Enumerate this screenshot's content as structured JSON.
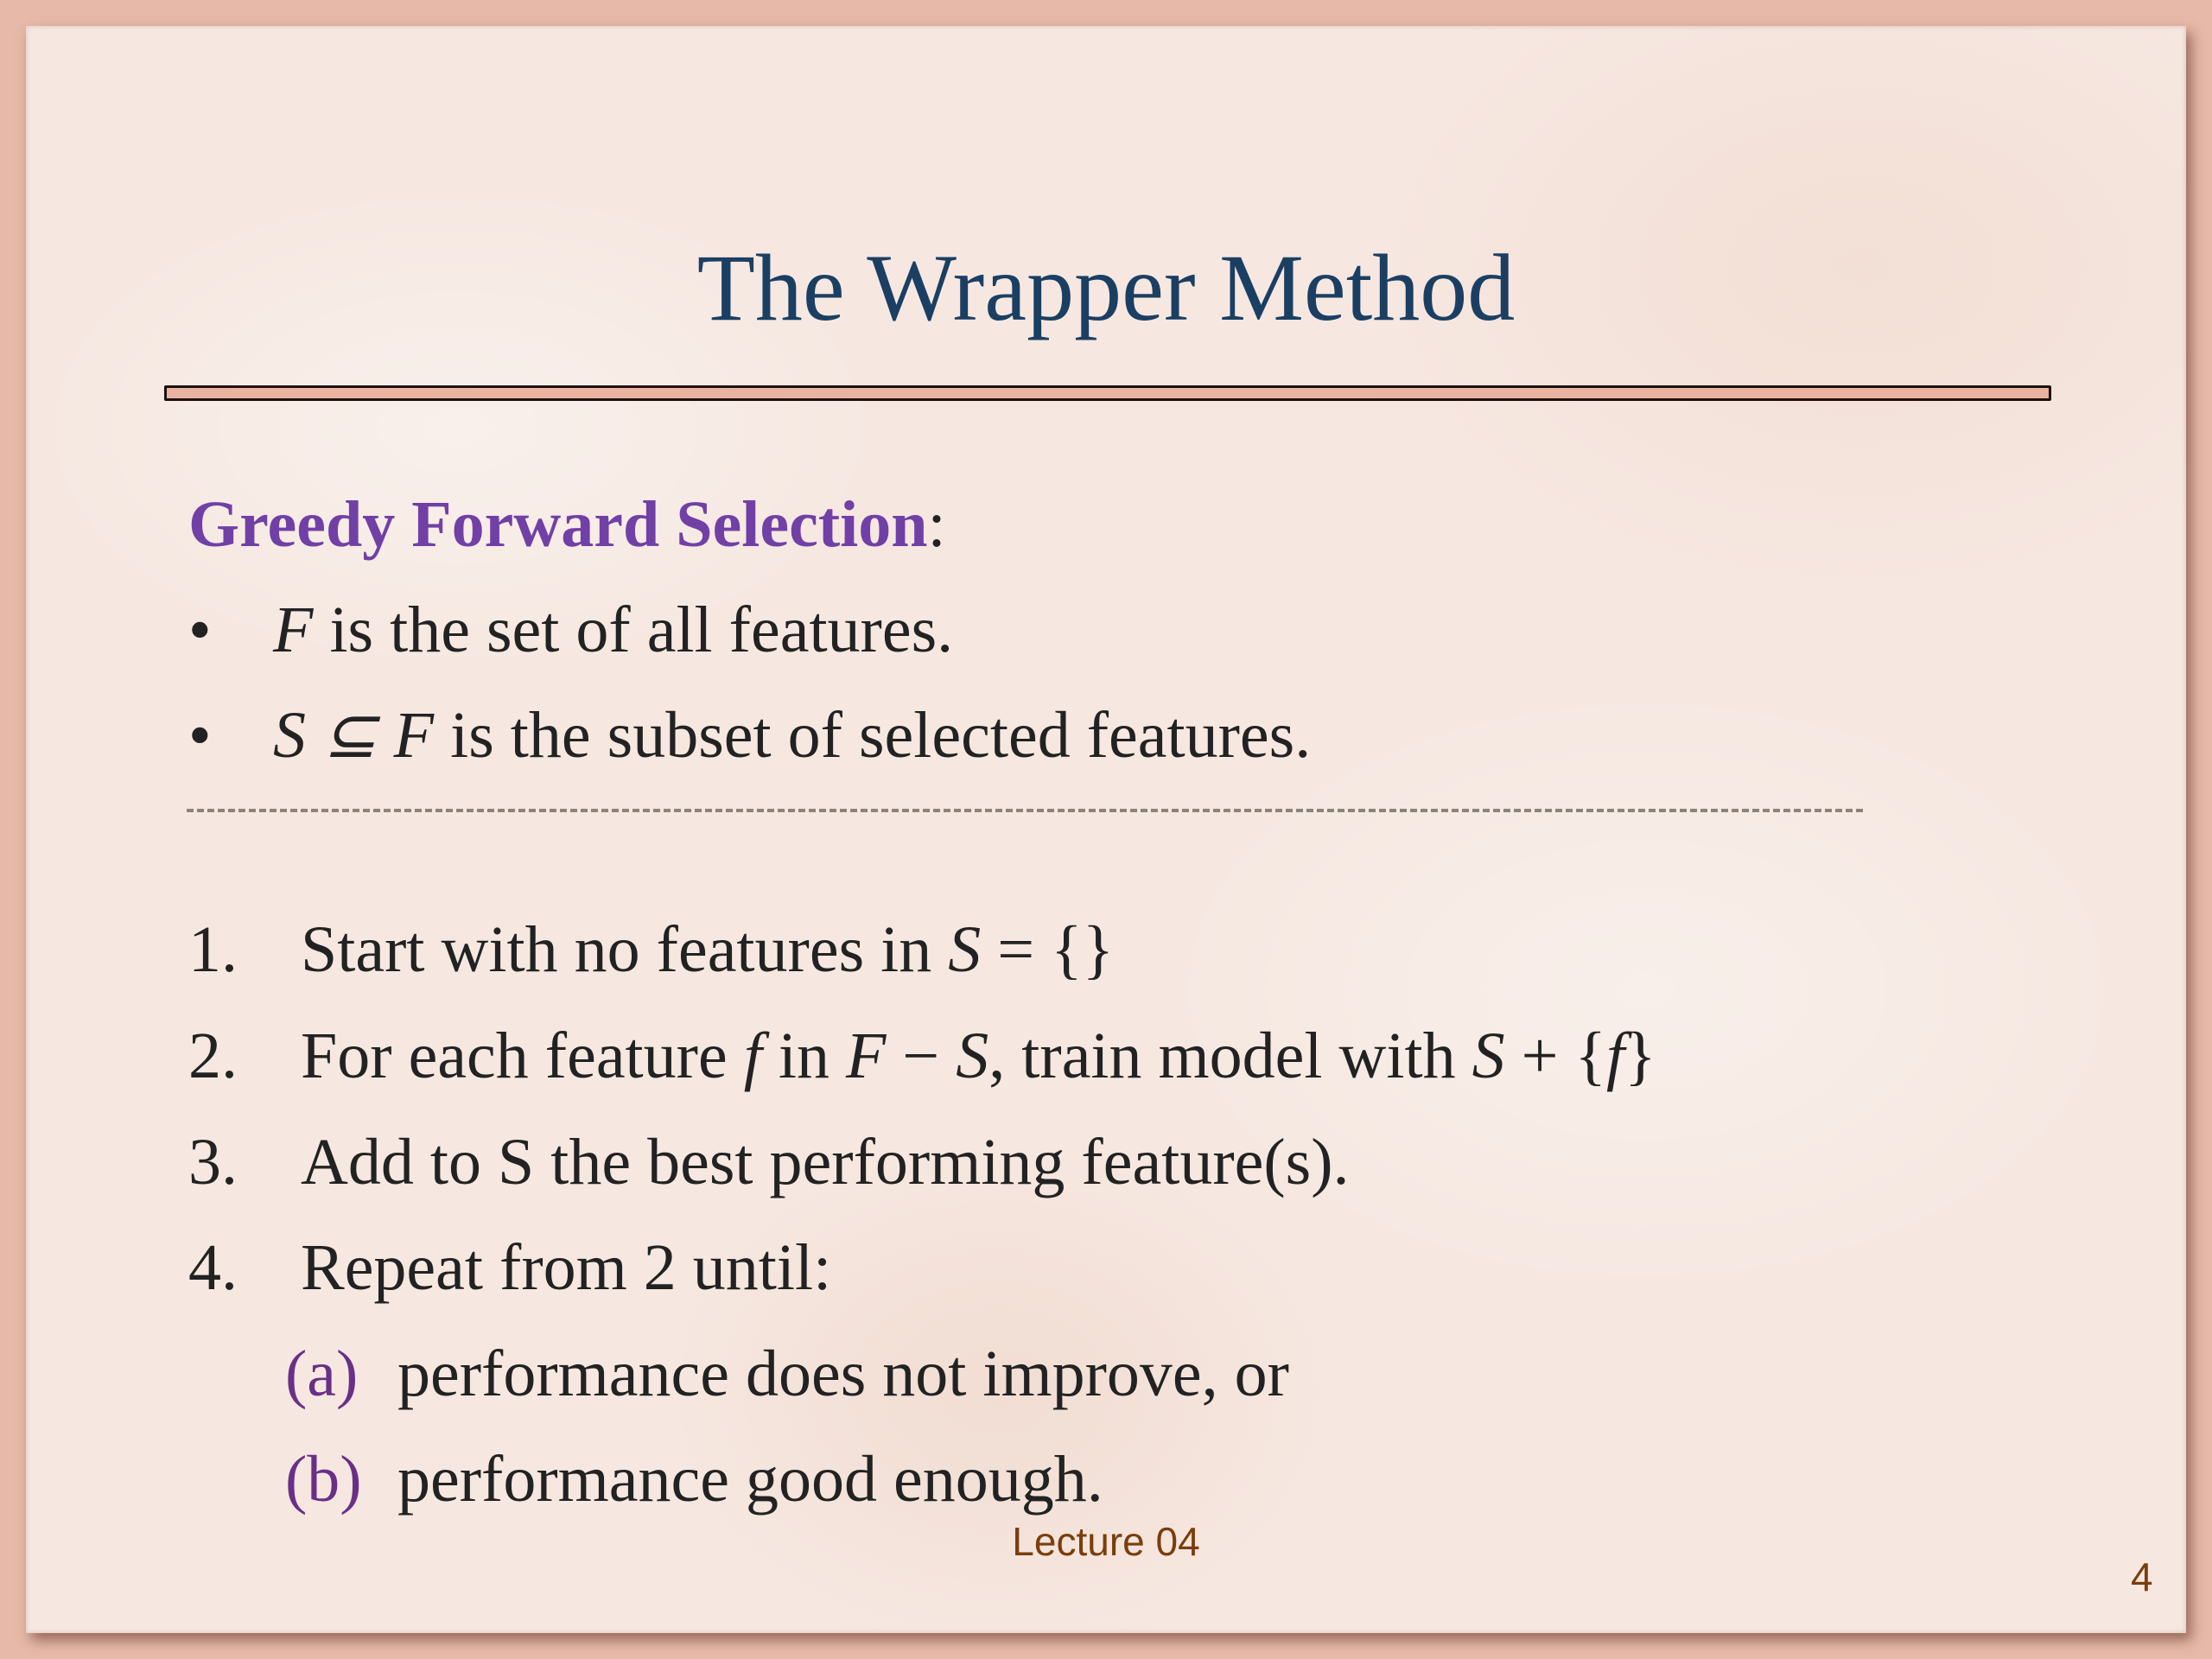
{
  "slide": {
    "title": "The Wrapper Method",
    "subheading": "Greedy Forward Selection",
    "subheading_suffix": ":",
    "bullets": [
      {
        "marker": "•",
        "math": "F",
        "text": " is the set of all features."
      },
      {
        "marker": "•",
        "math": "S ⊆ F",
        "text": " is the subset of selected features."
      }
    ],
    "steps": [
      {
        "num": "1.",
        "text": "Start with no features in ",
        "math": "S",
        "tail": " = {}"
      },
      {
        "num": "2.",
        "text": "For each feature ",
        "m1": "f",
        "t2": " in ",
        "m2": "F",
        "t3": " − ",
        "m3": "S",
        "t4": ", train model with ",
        "m4": "S",
        "t5": " + {",
        "m5": "f",
        "t6": "}"
      },
      {
        "num": "3.",
        "text": "Add to S the best performing feature(s)."
      },
      {
        "num": "4.",
        "text": "Repeat from 2 until:"
      }
    ],
    "substeps": [
      {
        "letter": "(a)",
        "text": "performance does not improve, or"
      },
      {
        "letter": "(b)",
        "text": "performance good enough."
      }
    ],
    "footer": "Lecture 04",
    "page_number": "4"
  },
  "colors": {
    "title": "#1b3f63",
    "subheading": "#7140a6",
    "sub_letters": "#6a2f86",
    "footer": "#7a3e0c",
    "rule_fill": "#e9b39f"
  }
}
